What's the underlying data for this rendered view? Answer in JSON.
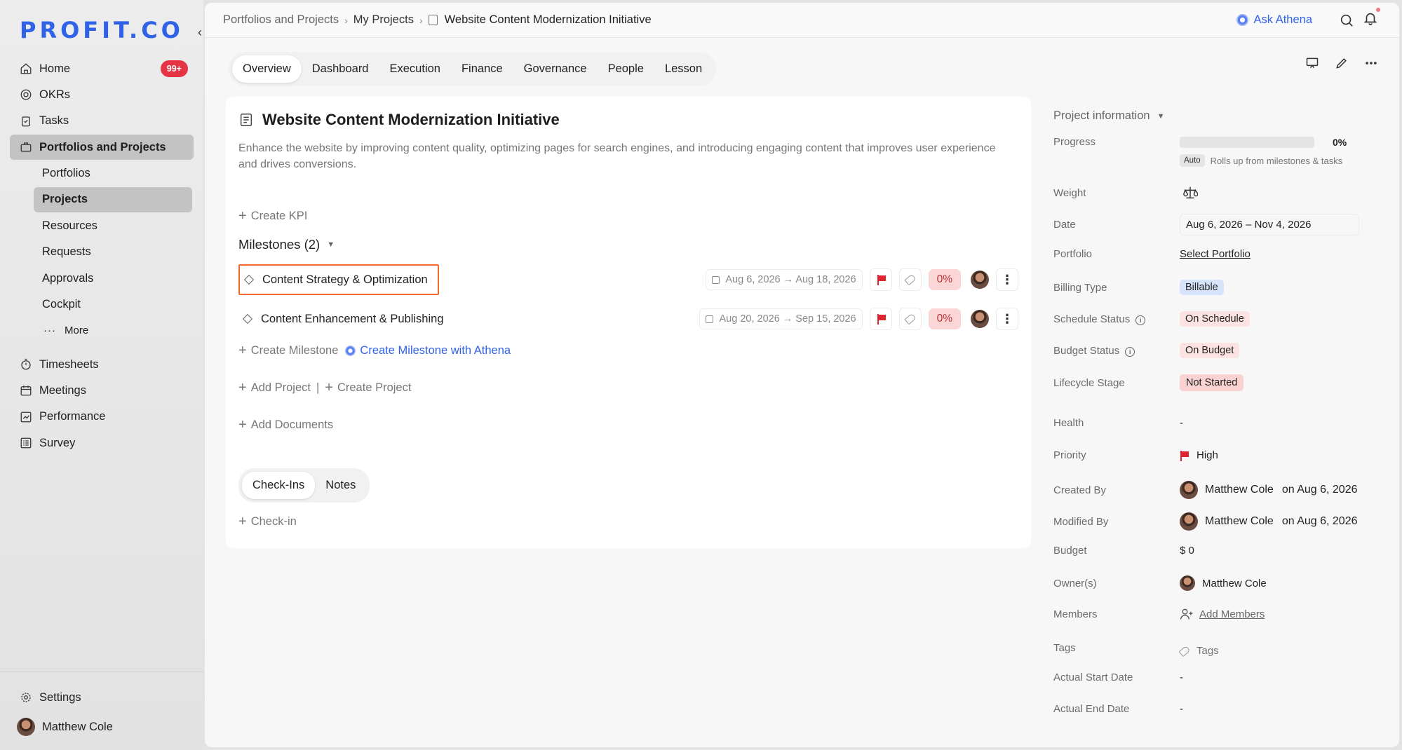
{
  "logo": "PROFIT.CO",
  "colors": {
    "brand": "#2f62e6",
    "badge": "#e53545",
    "highlight": "#ef6a2c",
    "flag": "#e0242f"
  },
  "sidebar": {
    "collapse_icon": "‹",
    "items": [
      {
        "label": "Home",
        "icon": "home-icon",
        "badge": "99+"
      },
      {
        "label": "OKRs",
        "icon": "target-icon"
      },
      {
        "label": "Tasks",
        "icon": "clipboard-icon"
      },
      {
        "label": "Portfolios and Projects",
        "icon": "briefcase-icon"
      }
    ],
    "sub_items": [
      "Portfolios",
      "Projects",
      "Resources",
      "Requests",
      "Approvals",
      "Cockpit"
    ],
    "more_label": "More",
    "items2": [
      {
        "label": "Timesheets",
        "icon": "stopwatch-icon"
      },
      {
        "label": "Meetings",
        "icon": "calendar-icon"
      },
      {
        "label": "Performance",
        "icon": "chart-icon"
      },
      {
        "label": "Survey",
        "icon": "survey-icon"
      }
    ],
    "settings_label": "Settings",
    "user_name": "Matthew Cole"
  },
  "breadcrumb": {
    "items": [
      "Portfolios and Projects",
      "My Projects",
      "Website Content Modernization Initiative"
    ]
  },
  "ask_athena": "Ask Athena",
  "tabs": [
    "Overview",
    "Dashboard",
    "Execution",
    "Finance",
    "Governance",
    "People",
    "Lesson"
  ],
  "project": {
    "title": "Website Content Modernization Initiative",
    "description": "Enhance the website by improving content quality, optimizing pages for search engines, and introducing engaging content that improves user experience and drives conversions.",
    "create_kpi": "Create KPI",
    "milestones_label": "Milestones",
    "milestones_count": "(2)",
    "milestones": [
      {
        "name": "Content Strategy & Optimization",
        "dates": "Aug 6, 2026 → Aug 18, 2026",
        "progress": "0%"
      },
      {
        "name": "Content Enhancement & Publishing",
        "dates": "Aug 20, 2026 → Sep 15, 2026",
        "progress": "0%"
      }
    ],
    "create_milestone": "Create Milestone",
    "create_milestone_athena": "Create Milestone with Athena",
    "add_project": "Add Project",
    "create_project": "Create Project",
    "add_documents": "Add Documents",
    "checkin_tabs": [
      "Check-Ins",
      "Notes"
    ],
    "checkin": "Check-in"
  },
  "info": {
    "heading": "Project information",
    "progress_label": "Progress",
    "progress_value": "0%",
    "progress_fraction": 0,
    "auto_chip": "Auto",
    "rollup_hint": "Rolls up from milestones & tasks",
    "weight_label": "Weight",
    "date_label": "Date",
    "date_value": "Aug 6, 2026 – Nov 4, 2026",
    "portfolio_label": "Portfolio",
    "portfolio_value": "Select Portfolio",
    "billing_label": "Billing Type",
    "billing_value": "Billable",
    "schedule_label": "Schedule Status",
    "schedule_value": "On Schedule",
    "budget_status_label": "Budget Status",
    "budget_status_value": "On Budget",
    "lifecycle_label": "Lifecycle Stage",
    "lifecycle_value": "Not Started",
    "health_label": "Health",
    "health_value": "-",
    "priority_label": "Priority",
    "priority_value": "High",
    "created_label": "Created By",
    "created_name": "Matthew Cole",
    "created_on": "on Aug 6, 2026",
    "modified_label": "Modified By",
    "modified_name": "Matthew Cole",
    "modified_on": "on Aug 6, 2026",
    "budget_label": "Budget",
    "budget_value": "$ 0",
    "owners_label": "Owner(s)",
    "owner_name": "Matthew Cole",
    "members_label": "Members",
    "members_value": "Add Members",
    "tags_label": "Tags",
    "tags_value": "Tags",
    "actual_start_label": "Actual Start Date",
    "actual_start_value": "-",
    "actual_end_label": "Actual End Date",
    "actual_end_value": "-"
  }
}
